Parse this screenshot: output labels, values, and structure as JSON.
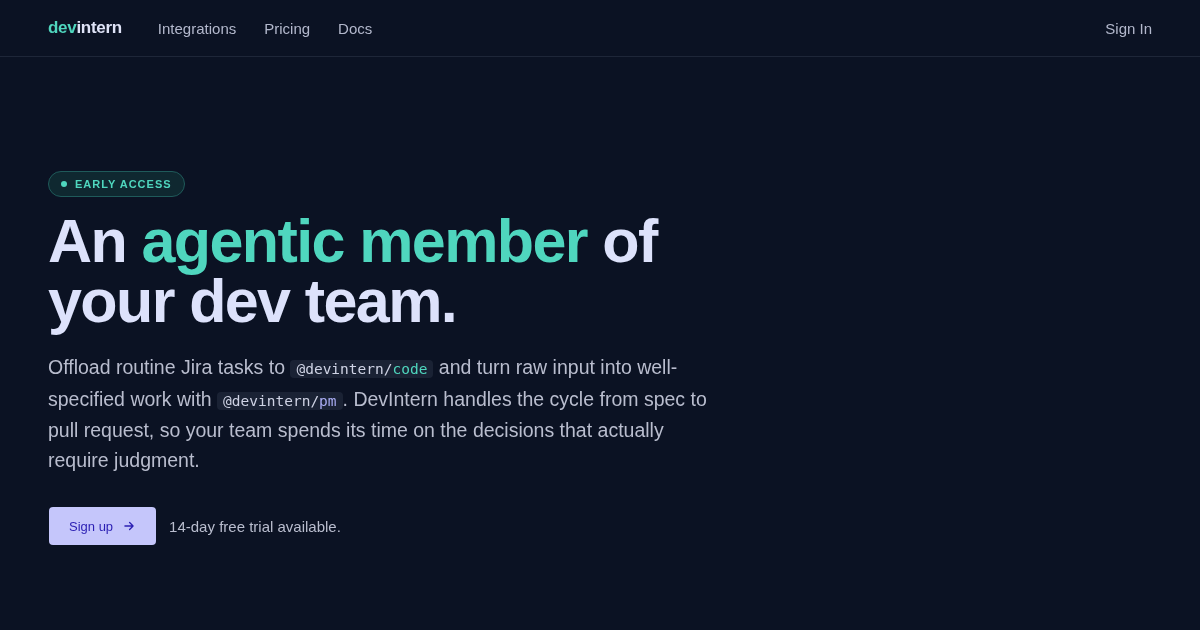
{
  "nav": {
    "logo": {
      "accent": "dev",
      "rest": "intern"
    },
    "links": [
      {
        "label": "Integrations"
      },
      {
        "label": "Pricing"
      },
      {
        "label": "Docs"
      }
    ],
    "sign_in": "Sign In"
  },
  "hero": {
    "badge": "EARLY ACCESS",
    "headline": [
      {
        "text": "An ",
        "highlight": false
      },
      {
        "text": "agentic member",
        "highlight": true
      },
      {
        "text": " of your dev team.",
        "highlight": false
      }
    ],
    "description": [
      {
        "kind": "text",
        "text": "Offload routine Jira tasks to "
      },
      {
        "kind": "code",
        "prefix": "@devintern/",
        "name": "code",
        "color": "#4fd6be"
      },
      {
        "kind": "text",
        "text": " and turn raw input into well-specified work with "
      },
      {
        "kind": "code",
        "prefix": "@devintern/",
        "name": "pm",
        "color": "#a9acf2"
      },
      {
        "kind": "text",
        "text": ". DevIntern handles the cycle from spec to pull request, so your team spends its time on the decisions that actually require judgment."
      }
    ],
    "cta": {
      "label": "Sign up"
    },
    "note": "14-day free trial available."
  }
}
